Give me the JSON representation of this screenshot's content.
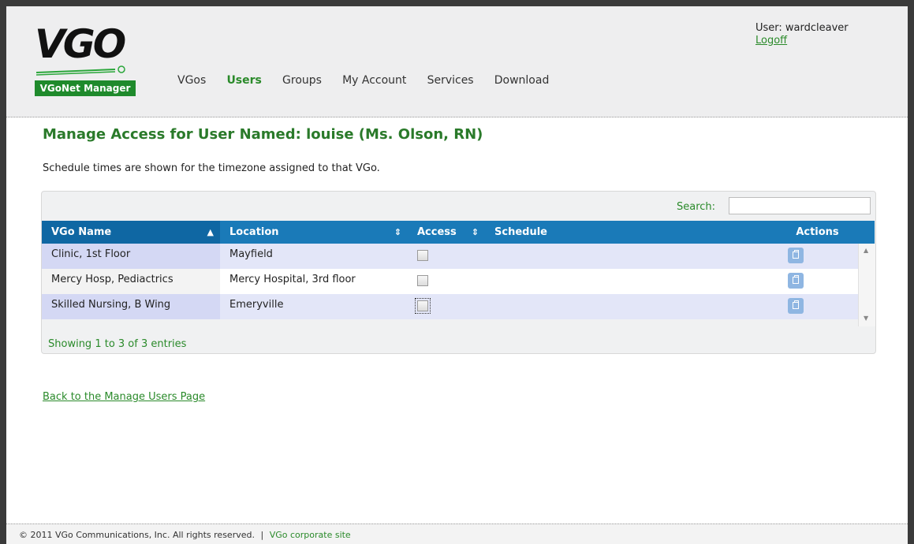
{
  "header": {
    "logo_text": "VGO",
    "badge": "VGoNet Manager",
    "nav": [
      {
        "label": "VGos",
        "active": false
      },
      {
        "label": "Users",
        "active": true
      },
      {
        "label": "Groups",
        "active": false
      },
      {
        "label": "My Account",
        "active": false
      },
      {
        "label": "Services",
        "active": false
      },
      {
        "label": "Download",
        "active": false
      }
    ],
    "user_label": "User: wardcleaver",
    "logoff": "Logoff"
  },
  "main": {
    "title": "Manage Access for User Named: louise (Ms. Olson, RN)",
    "timezone_note": "Schedule times are shown for the timezone assigned to that VGo.",
    "search_label": "Search:",
    "search_value": "",
    "columns": [
      "VGo Name",
      "Location",
      "Access",
      "Schedule",
      "Actions"
    ],
    "rows": [
      {
        "vgo_name": "Clinic, 1st Floor",
        "location": "Mayfield",
        "access": false,
        "schedule": ""
      },
      {
        "vgo_name": "Mercy Hosp, Pediactrics",
        "location": "Mercy Hospital, 3rd floor",
        "access": false,
        "schedule": ""
      },
      {
        "vgo_name": "Skilled Nursing, B Wing",
        "location": "Emeryville",
        "access": false,
        "schedule": ""
      }
    ],
    "info": "Showing 1 to 3 of 3 entries",
    "back_link": "Back to the Manage Users Page"
  },
  "footer": {
    "copyright": "© 2011 VGo Communications, Inc. All rights reserved.",
    "separator": "|",
    "corporate_link": "VGo corporate site"
  },
  "colors": {
    "accent_green": "#2a8a2a",
    "table_header_blue": "#1a7ab8",
    "badge_green": "#1f8a2c"
  }
}
